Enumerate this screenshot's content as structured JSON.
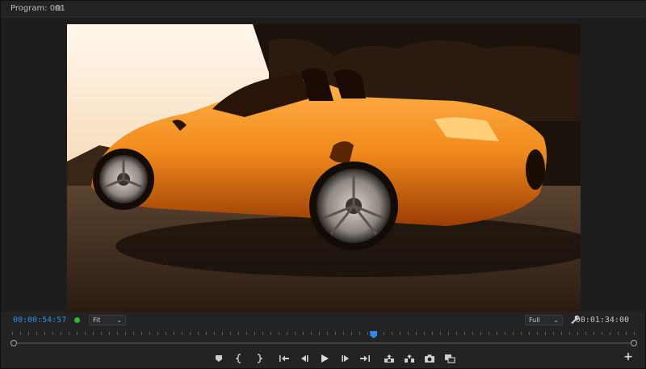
{
  "panel": {
    "title": "Program: 001",
    "menu_icon": "hamburger-menu-icon"
  },
  "viewer": {
    "content": "video-frame"
  },
  "controls": {
    "current_timecode": "00:00:54:57",
    "duration_timecode": "00:01:34:00",
    "zoom_select": "Fit",
    "resolution_select": "Full",
    "status_color": "#1fbf2b",
    "accent_color": "#2d8ceb"
  },
  "timeline": {
    "playhead_fraction": 0.58
  },
  "transport": {
    "buttons": [
      "add-marker-icon",
      "mark-in-icon",
      "mark-out-icon",
      "go-to-in-icon",
      "step-back-icon",
      "play-icon",
      "step-forward-icon",
      "go-to-out-icon",
      "lift-icon",
      "extract-icon",
      "export-frame-icon",
      "comparison-view-icon",
      "button-editor-plus-icon"
    ]
  }
}
